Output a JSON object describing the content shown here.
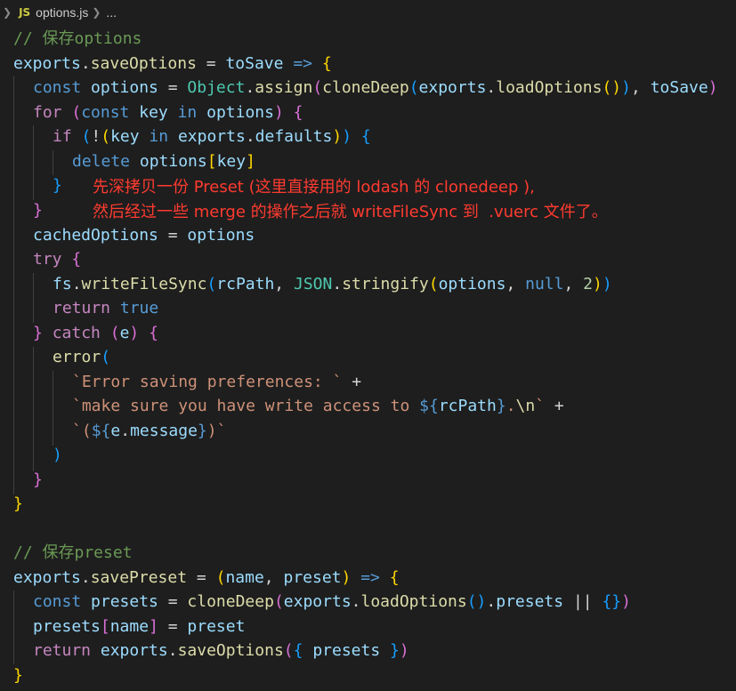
{
  "breadcrumb": {
    "lang_badge": "JS",
    "file": "options.js",
    "more": "..."
  },
  "annotations": {
    "line1": "先深拷贝一份 Preset (这里直接用的 lodash 的 clonedeep ),",
    "line2": "然后经过一些 merge 的操作之后就 writeFileSync 到  .vuerc 文件了。"
  },
  "code": {
    "c1": "// 保存options",
    "c2": "// 保存preset"
  }
}
